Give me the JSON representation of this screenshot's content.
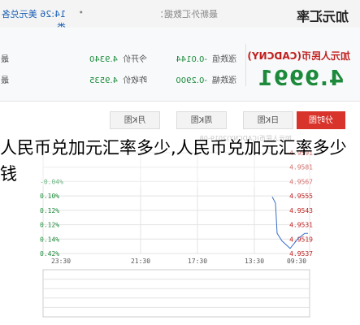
{
  "topbar": {
    "title": "加元汇率",
    "timestamp_prefix": "最新外汇数据：",
    "dot": "•",
    "time": "14:26 美元兑各类"
  },
  "quote": {
    "pair_name": "加元人民币(CADCNY)",
    "rate": "4.9991",
    "stats": [
      {
        "label": "涨跌值",
        "value": "-0.0144"
      },
      {
        "label": "今开价",
        "value": "4.9340"
      },
      {
        "label": "涨跌幅",
        "value": "-0.2900"
      },
      {
        "label": "昨收价",
        "value": "4.9535"
      }
    ],
    "edge_labels": [
      "最",
      "最"
    ]
  },
  "tabs": [
    {
      "label": "分时图",
      "active": true
    },
    {
      "label": "日K图",
      "active": false
    },
    {
      "label": "周K图",
      "active": false
    },
    {
      "label": "月K图",
      "active": false
    }
  ],
  "chart_legend": "加元人民币(CADCNY)2019-08",
  "overlay_text": "人民币兑加元汇率多少,人民币兑加元汇率多少钱",
  "chart_data": {
    "type": "line",
    "price_ticks": [
      "4.9591",
      "4.9581",
      "4.9567",
      "4.9555",
      "4.9543",
      "4.9531",
      "4.9519",
      "4.9537"
    ],
    "percent_ticks": [
      "-0.04%",
      "0.10%",
      "0.12%",
      "0.12%",
      "0.14%",
      "0.42%"
    ],
    "x_ticks": [
      "09:30",
      "13:30",
      "17:30",
      "21:30",
      "23:30"
    ],
    "series": [
      {
        "values": [
          4.9531,
          4.9531,
          4.9529,
          4.9527,
          4.9519,
          4.9525,
          4.9531,
          4.9555,
          4.956
        ]
      }
    ],
    "colors": {
      "line": "#3a6fc7",
      "grid": "#e3e3e3",
      "price_axis": "#c0201e",
      "percent_axis": "#1c8a3a"
    }
  }
}
